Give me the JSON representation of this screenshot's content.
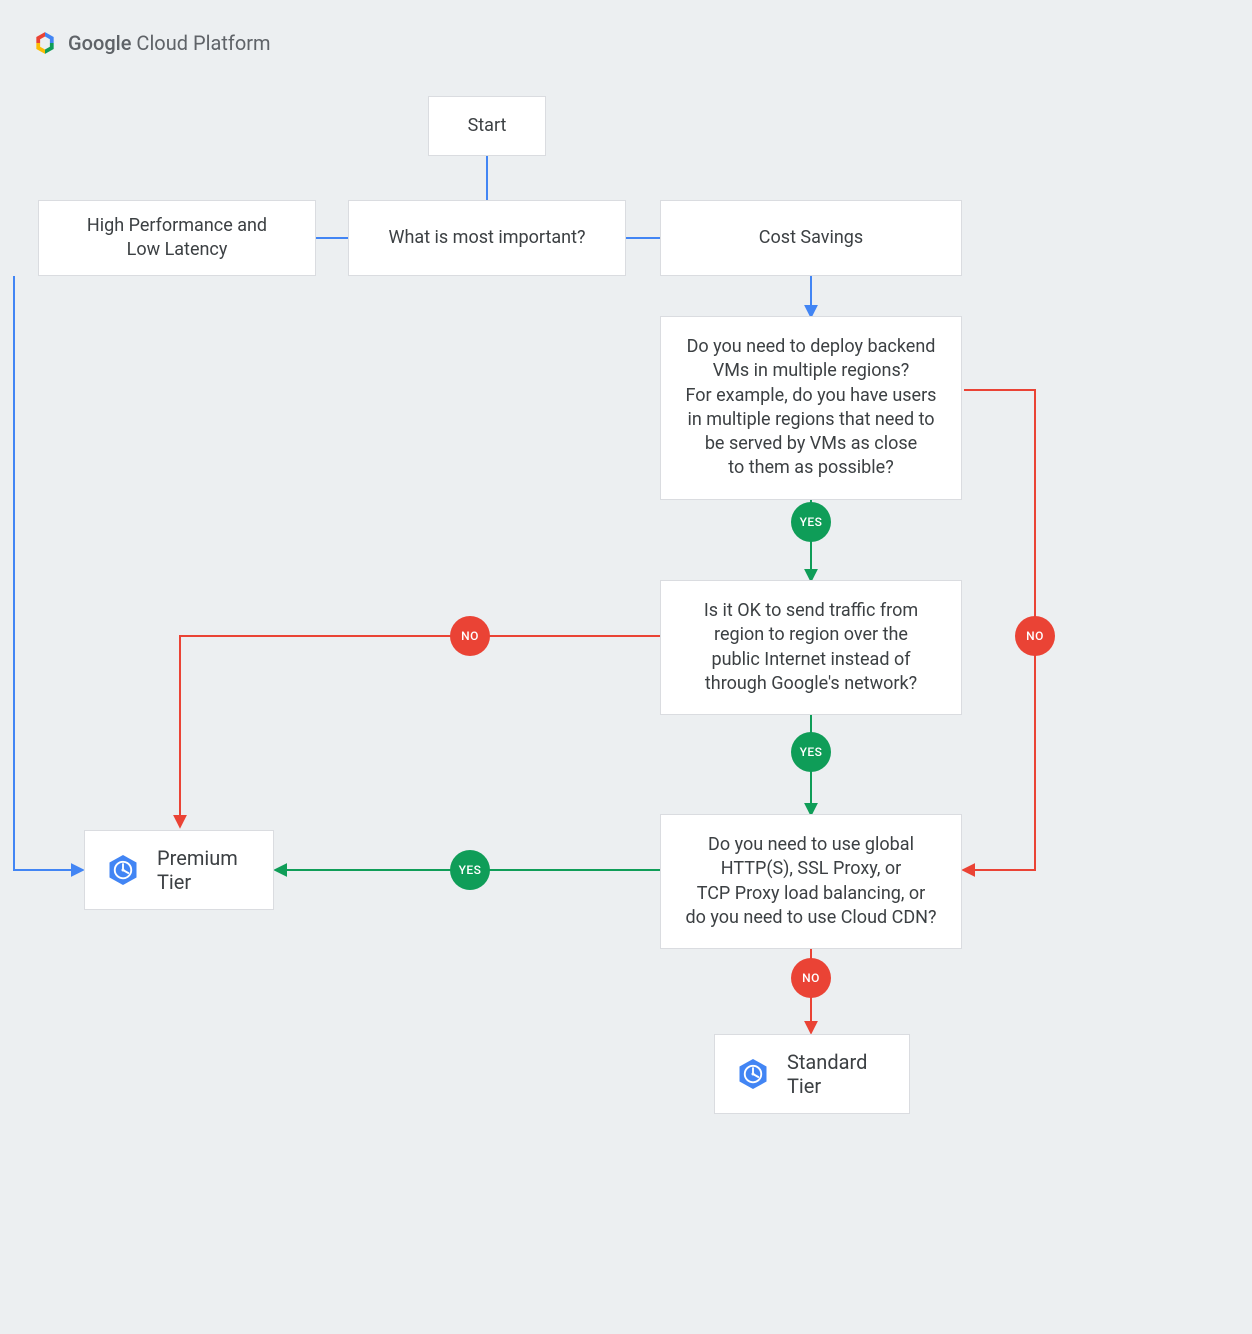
{
  "header": {
    "brand_google": "Google",
    "brand_rest": " Cloud Platform"
  },
  "nodes": {
    "start": "Start",
    "question_main": "What is most important?",
    "option_perf": "High Performance and\nLow Latency",
    "option_cost": "Cost Savings",
    "q_regions": "Do you need to deploy backend\nVMs in multiple regions?\nFor example, do you have users\nin multiple regions that need to\nbe served by VMs as close\nto them as possible?",
    "q_internet": "Is it OK to send traffic from\nregion to region over the\npublic Internet instead of\nthrough Google's network?",
    "q_global": "Do you need to use global\nHTTP(S), SSL Proxy, or\nTCP Proxy load balancing, or\ndo you need to use Cloud CDN?",
    "premium": "Premium Tier",
    "standard": "Standard Tier"
  },
  "badges": {
    "yes": "YES",
    "no": "NO"
  },
  "colors": {
    "blue": "#4285f4",
    "green": "#0f9d58",
    "red": "#ea4335"
  }
}
